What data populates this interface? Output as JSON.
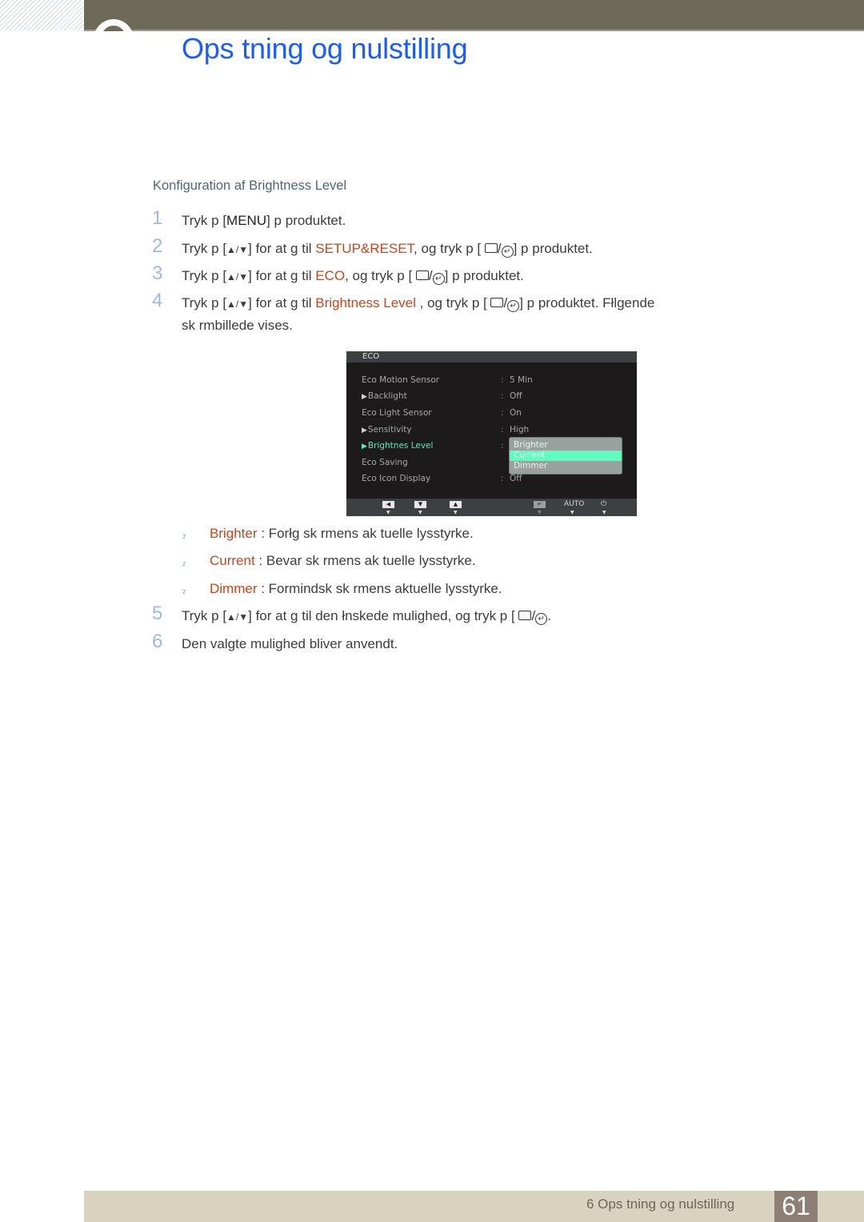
{
  "header": {
    "title": "Ops tning og nulstilling"
  },
  "section": {
    "heading": "Konfiguration af Brightness Level"
  },
  "steps": [
    {
      "num": "1",
      "parts": [
        "Tryk p  [",
        "MENU",
        "] p  produktet."
      ]
    },
    {
      "num": "2",
      "pre": "Tryk p  [",
      "mid": "] for at g  til ",
      "target": "SETUP&RESET",
      "post": ", og tryk p  [",
      "end": "] p  produktet."
    },
    {
      "num": "3",
      "pre": "Tryk p  [",
      "mid": "] for at g  til ",
      "target": "ECO",
      "post": ", og tryk p  [",
      "end": "] p  produktet."
    },
    {
      "num": "4",
      "pre": "Tryk p  [",
      "mid": "] for at g  til ",
      "target": "Brightness Level",
      "post": " , og tryk p  [",
      "end": "] p  produktet. Fłlgende",
      "line2": "sk rmbillede vises."
    },
    {
      "num": "5",
      "pre": "Tryk p  [",
      "mid": "] for at g  til den łnskede mulighed, og tryk p  [",
      "end": "."
    },
    {
      "num": "6",
      "text": "Den valgte mulighed bliver anvendt."
    }
  ],
  "osd": {
    "title": "ECO",
    "rows": [
      {
        "label": "Eco Motion Sensor",
        "value": "5 Min",
        "arrow": false,
        "active": false
      },
      {
        "label": "Backlight",
        "value": "Off",
        "arrow": true,
        "active": false
      },
      {
        "label": "Eco Light Sensor",
        "value": "On",
        "arrow": false,
        "active": false
      },
      {
        "label": "Sensitivity",
        "value": "High",
        "arrow": true,
        "active": false
      },
      {
        "label": "Brightnes Level",
        "value": "",
        "arrow": true,
        "active": true
      },
      {
        "label": "Eco Saving",
        "value": "",
        "arrow": false,
        "active": false
      },
      {
        "label": "Eco Icon Display",
        "value": "Off",
        "arrow": false,
        "active": false
      }
    ],
    "dropdown": {
      "options": [
        "Brighter",
        "Current",
        "Dimmer"
      ],
      "selected": "Current"
    },
    "buttons": {
      "auto": "AUTO"
    }
  },
  "bullets": [
    {
      "term": "Brighter",
      "desc": " : Forłg sk rmens ak  tuelle lysstyrke."
    },
    {
      "term": "Current",
      "desc": " : Bevar sk rmens ak tuelle lysstyrke."
    },
    {
      "term": "Dimmer",
      "desc": " : Formindsk sk rmens aktuelle lysstyrke."
    }
  ],
  "footer": {
    "chapter_label": "6 Ops tning og nulstilling",
    "page_number": "61"
  },
  "colors": {
    "title_blue": "#1a5cff",
    "highlight_orange": "#c9441a",
    "osd_active_green": "#5fe8b8",
    "footer_band": "#d9d2bf",
    "page_box": "#8e7f76"
  }
}
